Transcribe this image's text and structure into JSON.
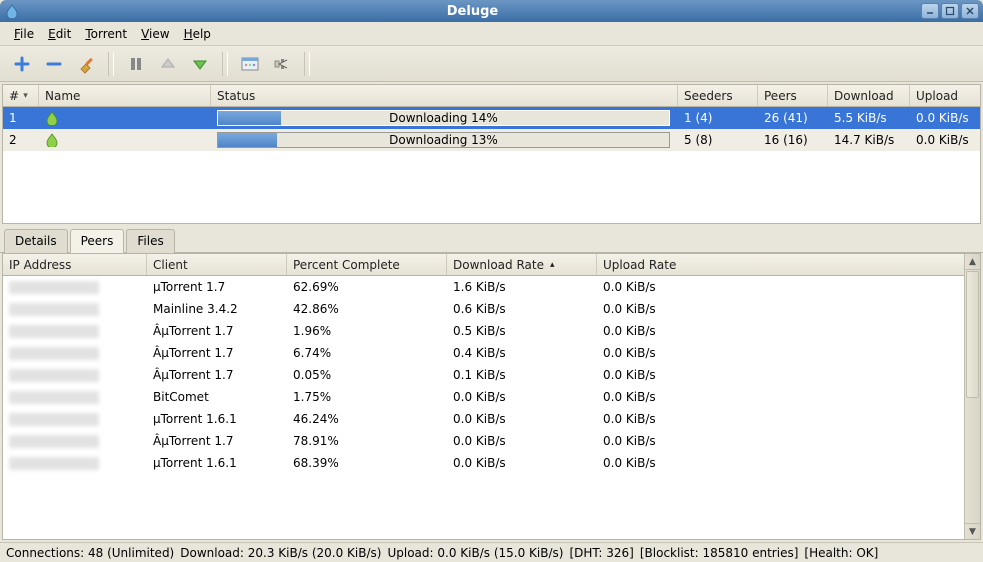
{
  "window": {
    "title": "Deluge"
  },
  "menu": {
    "file": "File",
    "edit": "Edit",
    "torrent": "Torrent",
    "view": "View",
    "help": "Help"
  },
  "torrent_headers": {
    "num": "#",
    "name": "Name",
    "status": "Status",
    "seeders": "Seeders",
    "peers": "Peers",
    "download": "Download",
    "upload": "Upload"
  },
  "torrents": [
    {
      "num": "1",
      "status_text": "Downloading 14%",
      "progress_pct": 14,
      "seeders": "1 (4)",
      "peers": "26 (41)",
      "download": "5.5 KiB/s",
      "upload": "0.0 KiB/s"
    },
    {
      "num": "2",
      "status_text": "Downloading 13%",
      "progress_pct": 13,
      "seeders": "5 (8)",
      "peers": "16 (16)",
      "download": "14.7 KiB/s",
      "upload": "0.0 KiB/s"
    }
  ],
  "tabs": {
    "details": "Details",
    "peers": "Peers",
    "files": "Files"
  },
  "peer_headers": {
    "ip": "IP Address",
    "client": "Client",
    "pct": "Percent Complete",
    "dr": "Download Rate",
    "ur": "Upload Rate"
  },
  "peers": [
    {
      "client": "µTorrent 1.7",
      "pct": "62.69%",
      "dr": "1.6 KiB/s",
      "ur": "0.0 KiB/s"
    },
    {
      "client": "Mainline 3.4.2",
      "pct": "42.86%",
      "dr": "0.6 KiB/s",
      "ur": "0.0 KiB/s"
    },
    {
      "client": "ÂµTorrent 1.7",
      "pct": "1.96%",
      "dr": "0.5 KiB/s",
      "ur": "0.0 KiB/s"
    },
    {
      "client": "ÂµTorrent 1.7",
      "pct": "6.74%",
      "dr": "0.4 KiB/s",
      "ur": "0.0 KiB/s"
    },
    {
      "client": "ÂµTorrent 1.7",
      "pct": "0.05%",
      "dr": "0.1 KiB/s",
      "ur": "0.0 KiB/s"
    },
    {
      "client": "BitComet",
      "pct": "1.75%",
      "dr": "0.0 KiB/s",
      "ur": "0.0 KiB/s"
    },
    {
      "client": "µTorrent 1.6.1",
      "pct": "46.24%",
      "dr": "0.0 KiB/s",
      "ur": "0.0 KiB/s"
    },
    {
      "client": "ÂµTorrent 1.7",
      "pct": "78.91%",
      "dr": "0.0 KiB/s",
      "ur": "0.0 KiB/s"
    },
    {
      "client": "µTorrent 1.6.1",
      "pct": "68.39%",
      "dr": "0.0 KiB/s",
      "ur": "0.0 KiB/s"
    }
  ],
  "status": {
    "connections": "Connections: 48 (Unlimited)",
    "download": "Download: 20.3 KiB/s (20.0 KiB/s)",
    "upload": "Upload: 0.0 KiB/s (15.0 KiB/s)",
    "dht": "[DHT: 326]",
    "blocklist": "[Blocklist: 185810 entries]",
    "health": "[Health: OK]"
  }
}
